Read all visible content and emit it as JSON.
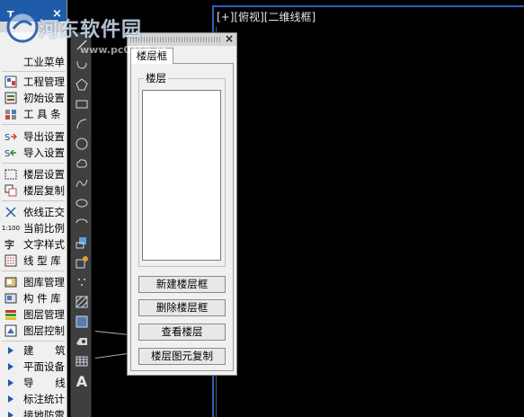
{
  "left_panel": {
    "title_text": "T",
    "close_symbol": "×",
    "sub_item": "工业菜单",
    "items": [
      {
        "label": "工程管理",
        "icon": "project-icon"
      },
      {
        "label": "初始设置",
        "icon": "settings-icon"
      },
      {
        "label": "工 具 条",
        "icon": "toolbar-icon"
      },
      {
        "label": "导出设置",
        "icon": "export-icon"
      },
      {
        "label": "导入设置",
        "icon": "import-icon"
      },
      {
        "label": "楼层设置",
        "icon": "floor-settings-icon"
      },
      {
        "label": "楼层复制",
        "icon": "floor-copy-icon"
      },
      {
        "label": "依线正交",
        "icon": "ortho-icon"
      },
      {
        "label": "当前比例",
        "icon": "scale-icon"
      },
      {
        "label": "文字样式",
        "icon": "text-style-icon"
      },
      {
        "label": "线 型 库",
        "icon": "linetype-icon"
      },
      {
        "label": "图库管理",
        "icon": "library-icon"
      },
      {
        "label": "构 件 库",
        "icon": "component-icon"
      },
      {
        "label": "图层管理",
        "icon": "layer-manage-icon"
      },
      {
        "label": "图层控制",
        "icon": "layer-control-icon"
      },
      {
        "label": "建 筑",
        "icon": "triangle-right-icon"
      },
      {
        "label": "平面设备",
        "icon": "triangle-right-icon"
      },
      {
        "label": "导 线",
        "icon": "triangle-right-icon"
      },
      {
        "label": "标注统计",
        "icon": "triangle-right-icon"
      },
      {
        "label": "接地防雷",
        "icon": "triangle-right-icon"
      }
    ],
    "scale_text": "1:100"
  },
  "viewport": {
    "label": "[+][俯视][二维线框]"
  },
  "dialog": {
    "tab": "楼层框",
    "group_label": "楼层",
    "close_symbol": "×",
    "buttons": {
      "new": "新建楼层框",
      "delete": "删除楼层框",
      "view": "查看楼层",
      "copy": "楼层图元复制"
    }
  },
  "watermark": {
    "text": "河东软件园",
    "url": "www.pc0359.cn"
  },
  "toolbar": {
    "text_tool_glyph": "A"
  },
  "colors": {
    "canvas": "#000000",
    "viewport_border": "#2d5fb9",
    "panel": "#f0f0f0",
    "toolbar": "#3f3f3f"
  }
}
